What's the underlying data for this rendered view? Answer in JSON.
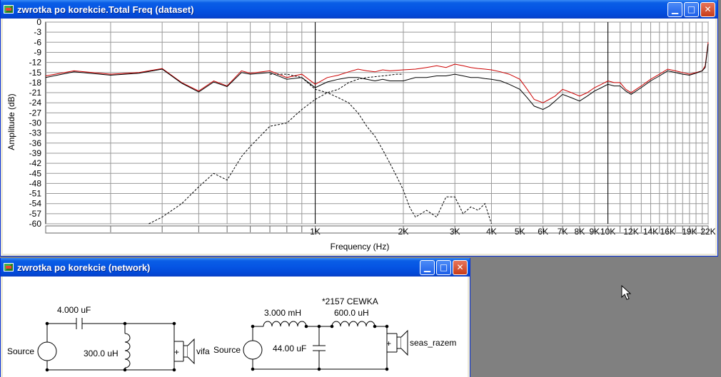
{
  "freq_window": {
    "title": "zwrotka po korekcie.Total Freq (dataset)",
    "buttons": {
      "minimize": "▁",
      "maximize": "□",
      "close": "✕"
    }
  },
  "network_window": {
    "title": "zwrotka po korekcie (network)",
    "buttons": {
      "minimize": "▁",
      "maximize": "□",
      "close": "✕"
    }
  },
  "chart_data": {
    "type": "line",
    "xlabel": "Frequency (Hz)",
    "ylabel": "Amplitude (dB)",
    "x_scale": "log",
    "xlim": [
      120,
      22000
    ],
    "ylim": [
      -60,
      0
    ],
    "y_ticks": [
      0,
      -3,
      -6,
      -9,
      -12,
      -15,
      -18,
      -21,
      -24,
      -27,
      -30,
      -33,
      -36,
      -39,
      -42,
      -45,
      -48,
      -51,
      -54,
      -57,
      -60
    ],
    "x_ticks": [
      {
        "value": 1000,
        "label": "1K"
      },
      {
        "value": 2000,
        "label": "2K"
      },
      {
        "value": 3000,
        "label": "3K"
      },
      {
        "value": 4000,
        "label": "4K"
      },
      {
        "value": 5000,
        "label": "5K"
      },
      {
        "value": 6000,
        "label": "6K"
      },
      {
        "value": 7000,
        "label": "7K"
      },
      {
        "value": 8000,
        "label": "8K"
      },
      {
        "value": 9000,
        "label": "9K"
      },
      {
        "value": 10000,
        "label": "10K"
      },
      {
        "value": 12000,
        "label": "12K"
      },
      {
        "value": 14000,
        "label": "14K"
      },
      {
        "value": 16000,
        "label": "16K"
      },
      {
        "value": 19000,
        "label": "19K"
      },
      {
        "value": 22000,
        "label": "22K"
      }
    ],
    "grid": true,
    "series": [
      {
        "color": "#cc0000",
        "style": "solid",
        "x": [
          120,
          150,
          200,
          250,
          300,
          350,
          400,
          450,
          500,
          560,
          600,
          700,
          800,
          900,
          1000,
          1100,
          1200,
          1300,
          1400,
          1500,
          1600,
          1700,
          1800,
          2000,
          2200,
          2400,
          2600,
          2800,
          3000,
          3200,
          3400,
          3600,
          3800,
          4000,
          4300,
          4600,
          5000,
          5300,
          5600,
          6000,
          6300,
          6600,
          7000,
          7500,
          8000,
          8500,
          9000,
          9500,
          10000,
          10500,
          11000,
          11500,
          12000,
          13000,
          14000,
          15000,
          16000,
          17000,
          18000,
          19000,
          20000,
          21000,
          21500,
          22000
        ],
        "y": [
          -16,
          -14.5,
          -15.5,
          -15,
          -13.8,
          -18,
          -20.5,
          -17.5,
          -19,
          -14.5,
          -15.2,
          -14.5,
          -16.5,
          -15.5,
          -18.5,
          -16.5,
          -15.8,
          -14.8,
          -14,
          -14.5,
          -14.8,
          -14.2,
          -14.5,
          -14.2,
          -14,
          -13.5,
          -13,
          -13.5,
          -12.5,
          -13,
          -13.5,
          -13.8,
          -14,
          -14.2,
          -14.8,
          -15.5,
          -17,
          -20,
          -23,
          -24,
          -23,
          -22,
          -20,
          -21,
          -22,
          -21,
          -19.5,
          -18.5,
          -17.5,
          -18,
          -18,
          -20,
          -21,
          -19,
          -17,
          -15.5,
          -14,
          -14.5,
          -15,
          -15.5,
          -15,
          -14.5,
          -13,
          -6
        ]
      },
      {
        "color": "#000000",
        "style": "solid",
        "x": [
          120,
          150,
          200,
          250,
          300,
          350,
          400,
          450,
          500,
          560,
          600,
          700,
          800,
          900,
          1000,
          1100,
          1200,
          1300,
          1400,
          1500,
          1600,
          1700,
          1800,
          2000,
          2200,
          2400,
          2600,
          2800,
          3000,
          3200,
          3400,
          3600,
          3800,
          4000,
          4300,
          4600,
          5000,
          5300,
          5600,
          6000,
          6300,
          6600,
          7000,
          7500,
          8000,
          8500,
          9000,
          9500,
          10000,
          10500,
          11000,
          11500,
          12000,
          13000,
          14000,
          15000,
          16000,
          17000,
          18000,
          19000,
          20000,
          21000,
          21500,
          22000
        ],
        "y": [
          -16.5,
          -14.8,
          -15.8,
          -15.2,
          -14,
          -18.2,
          -20.8,
          -17.8,
          -19.2,
          -15,
          -15.5,
          -15,
          -17,
          -16.5,
          -19.5,
          -17.8,
          -17,
          -16.5,
          -16.5,
          -17,
          -17.5,
          -17,
          -17.5,
          -17.5,
          -16.5,
          -16.5,
          -16,
          -16,
          -15.5,
          -16,
          -16.5,
          -16.5,
          -16.8,
          -17,
          -17.5,
          -18.5,
          -20,
          -22.5,
          -25,
          -26,
          -25,
          -23.5,
          -21.5,
          -22.5,
          -23.5,
          -22,
          -20.5,
          -19.5,
          -18.5,
          -19,
          -19,
          -20.5,
          -21.5,
          -19.5,
          -17.5,
          -16,
          -14.5,
          -15,
          -15.5,
          -15.8,
          -15.2,
          -14.5,
          -13.5,
          -6.5
        ]
      },
      {
        "color": "#000000",
        "style": "dashed",
        "x": [
          270,
          300,
          350,
          400,
          450,
          500,
          560,
          600,
          700,
          800,
          900,
          1000,
          1100,
          1200,
          1300,
          1400,
          1500,
          1700,
          1900,
          2000
        ],
        "y": [
          -60,
          -58,
          -54,
          -49,
          -45,
          -47,
          -40,
          -37,
          -31,
          -30,
          -26,
          -23,
          -21,
          -20,
          -18,
          -17,
          -16.5,
          -16,
          -15.5,
          -15.5
        ]
      },
      {
        "color": "#000000",
        "style": "dashed",
        "x": [
          700,
          800,
          900,
          1000,
          1050,
          1100,
          1200,
          1300,
          1400,
          1500,
          1600,
          1700,
          1800,
          1900,
          2000,
          2100,
          2200,
          2400,
          2600,
          2800,
          3000,
          3200,
          3400,
          3600,
          3800,
          4000
        ],
        "y": [
          -15.5,
          -15.5,
          -16.5,
          -20,
          -20.5,
          -21,
          -22.5,
          -24,
          -27,
          -31,
          -34,
          -38,
          -42,
          -46,
          -50,
          -55,
          -58,
          -56,
          -58,
          -52,
          -52,
          -57,
          -55,
          -56,
          -54,
          -60
        ]
      }
    ]
  },
  "schematic": {
    "left": {
      "source_label": "Source",
      "capacitor_label": "4.000 uF",
      "inductor_label": "300.0 uH",
      "speaker_label": "vifa",
      "speaker_plus": "+"
    },
    "right": {
      "source_label": "Source",
      "inductor1_label": "3.000 mH",
      "inductor2_title": "*2157 CEWKA",
      "inductor2_label": "600.0 uH",
      "capacitor_label": "44.00 uF",
      "speaker_label": "seas_razem",
      "speaker_plus": "+"
    }
  }
}
